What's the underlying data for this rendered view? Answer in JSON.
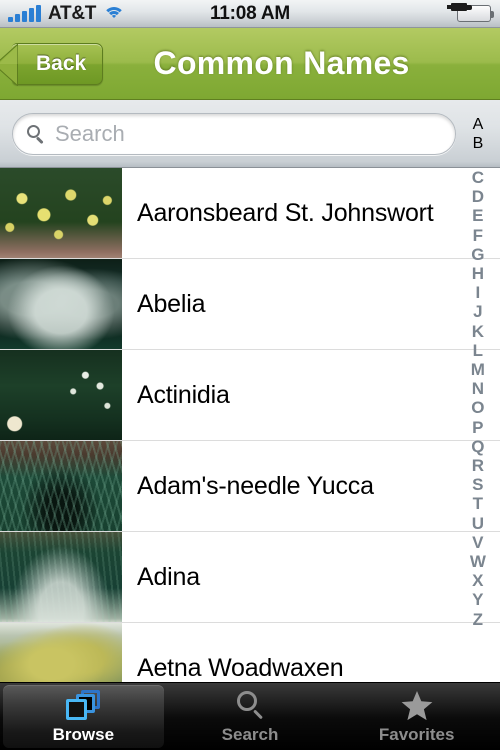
{
  "statusbar": {
    "carrier": "AT&T",
    "time": "11:08 AM",
    "signal_icon": "signal-bars-icon",
    "wifi_icon": "wifi-icon",
    "battery_icon": "battery-charging-icon"
  },
  "navbar": {
    "back_label": "Back",
    "title": "Common Names"
  },
  "search": {
    "placeholder": "Search",
    "value": "",
    "icon": "search-icon"
  },
  "index": {
    "letters": [
      "A",
      "B",
      "C",
      "D",
      "E",
      "F",
      "G",
      "H",
      "I",
      "J",
      "K",
      "L",
      "M",
      "N",
      "O",
      "P",
      "Q",
      "R",
      "S",
      "T",
      "U",
      "V",
      "W",
      "X",
      "Y",
      "Z"
    ]
  },
  "list": {
    "rows": [
      {
        "label": "Aaronsbeard St. Johnswort",
        "thumb": "t0"
      },
      {
        "label": "Abelia",
        "thumb": "t1"
      },
      {
        "label": "Actinidia",
        "thumb": "t2"
      },
      {
        "label": "Adam's-needle Yucca",
        "thumb": "t3"
      },
      {
        "label": "Adina",
        "thumb": "t4"
      },
      {
        "label": "Aetna Woadwaxen",
        "thumb": "t5"
      }
    ]
  },
  "tabbar": {
    "tabs": [
      {
        "label": "Browse",
        "icon": "stacked-squares-icon",
        "active": true
      },
      {
        "label": "Search",
        "icon": "search-icon",
        "active": false
      },
      {
        "label": "Favorites",
        "icon": "star-icon",
        "active": false
      }
    ]
  },
  "colors": {
    "nav_green": "#8ab03c",
    "tab_active_blue": "#49b7f5",
    "index_gray": "#7b858f"
  }
}
